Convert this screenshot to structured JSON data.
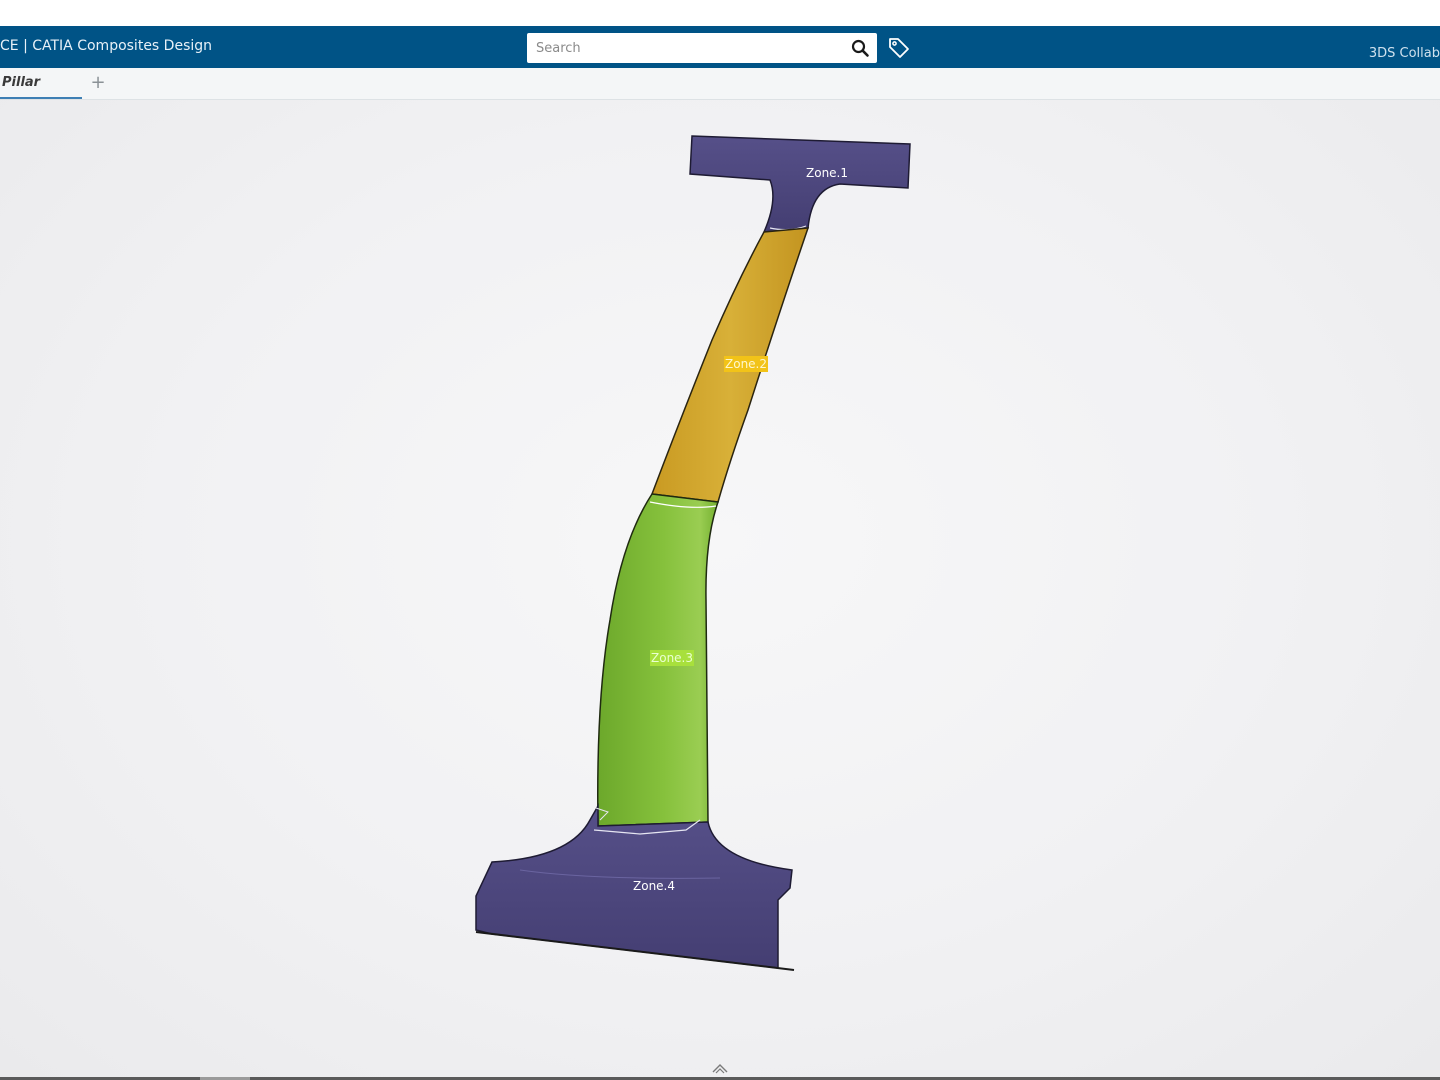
{
  "header": {
    "app_title": "CE | CATIA Composites Design",
    "search_placeholder": "Search",
    "brand_right": "3DS Collab"
  },
  "tabs": [
    {
      "label": "Pillar",
      "active": true
    }
  ],
  "tab_add_label": "+",
  "viewport": {
    "zones": [
      {
        "label": "Zone.1",
        "color": "#4a4478"
      },
      {
        "label": "Zone.2",
        "color": "#d4ab2e"
      },
      {
        "label": "Zone.3",
        "color": "#7db834"
      },
      {
        "label": "Zone.4",
        "color": "#4a4478"
      }
    ]
  },
  "colors": {
    "topbar": "#005386",
    "tab_underline": "#3d7fb4",
    "zone2_label_bg": "#f2c318",
    "zone3_label_bg": "#a8e03c"
  },
  "icons": {
    "search": "search-icon",
    "tag": "tag-icon",
    "expand": "chevron-up-icon"
  }
}
